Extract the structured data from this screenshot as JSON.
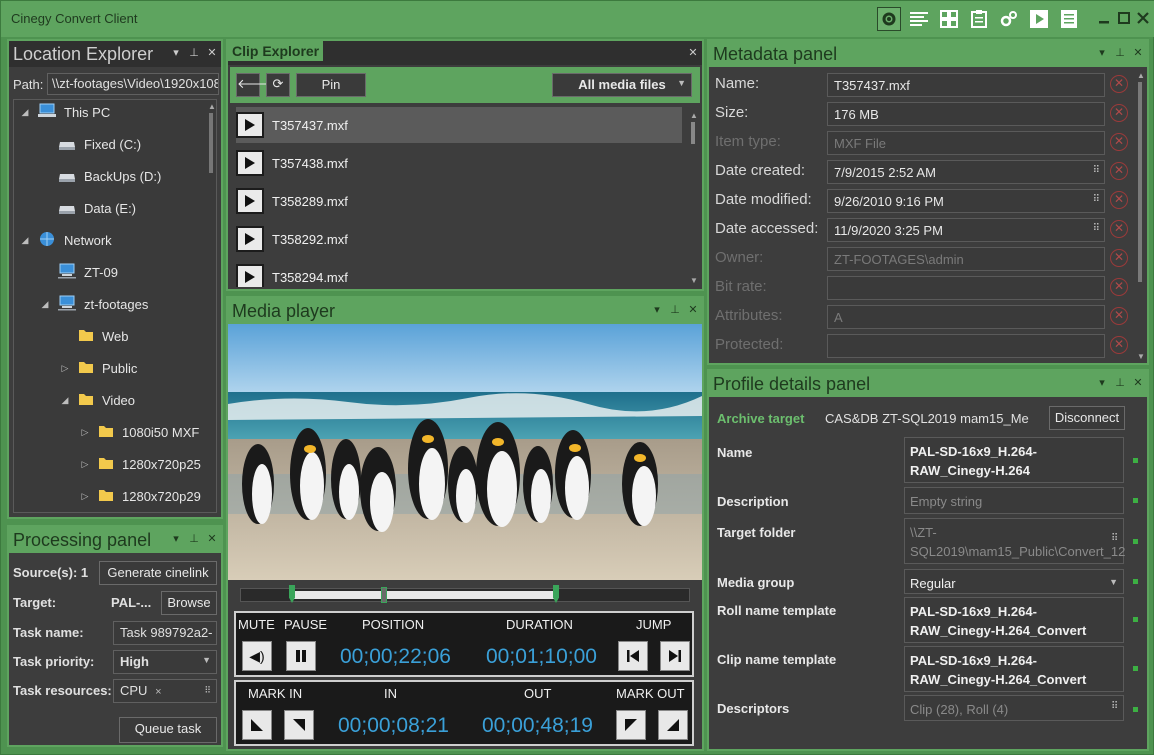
{
  "window": {
    "title": "Cinegy Convert Client"
  },
  "toolbar": {
    "icons": [
      "gear-icon",
      "list-icon",
      "grid-icon",
      "clipboard-icon",
      "settings-cogs-icon",
      "play-icon",
      "document-list-icon"
    ]
  },
  "location": {
    "title": "Location Explorer",
    "path_label": "Path:",
    "path_value": "\\\\zt-footages\\Video\\1920x108",
    "tree": [
      {
        "label": "This PC",
        "indent": 0,
        "arrow": "▲"
      },
      {
        "label": "Fixed (C:)",
        "indent": 1,
        "arrow": ""
      },
      {
        "label": "BackUps (D:)",
        "indent": 1,
        "arrow": ""
      },
      {
        "label": "Data (E:)",
        "indent": 1,
        "arrow": ""
      },
      {
        "label": "Network",
        "indent": 0,
        "arrow": "▲"
      },
      {
        "label": "ZT-09",
        "indent": 1,
        "arrow": ""
      },
      {
        "label": "zt-footages",
        "indent": 1,
        "arrow": "▲"
      },
      {
        "label": "Web",
        "indent": 2,
        "arrow": ""
      },
      {
        "label": "Public",
        "indent": 2,
        "arrow": "▶"
      },
      {
        "label": "Video",
        "indent": 2,
        "arrow": "▲"
      },
      {
        "label": "1080i50 MXF",
        "indent": 3,
        "arrow": "▶"
      },
      {
        "label": "1280x720p25",
        "indent": 3,
        "arrow": "▶"
      },
      {
        "label": "1280x720p29",
        "indent": 3,
        "arrow": "▶"
      }
    ]
  },
  "processing": {
    "title": "Processing panel",
    "sources_label": "Source(s): 1",
    "generate_btn": "Generate cinelink",
    "target_label": "Target:",
    "target_value": "PAL-...",
    "browse_btn": "Browse",
    "taskname_label": "Task name:",
    "taskname_value": "Task 989792a2-",
    "priority_label": "Task priority:",
    "priority_value": "High",
    "resources_label": "Task resources:",
    "resources_tag": "CPU",
    "queue_btn": "Queue task"
  },
  "clips": {
    "title": "Clip Explorer",
    "pin_btn": "Pin",
    "filter_value": "All media files",
    "items": [
      "T357437.mxf",
      "T357438.mxf",
      "T358289.mxf",
      "T358292.mxf",
      "T358294.mxf"
    ]
  },
  "player": {
    "title": "Media player",
    "mute_label": "MUTE",
    "pause_label": "PAUSE",
    "position_label": "POSITION",
    "position_value": "00;00;22;06",
    "duration_label": "DURATION",
    "duration_value": "00;01;10;00",
    "jump_label": "JUMP",
    "markin_label": "MARK IN",
    "in_label": "IN",
    "in_value": "00;00;08;21",
    "out_label": "OUT",
    "out_value": "00;00;48;19",
    "markout_label": "MARK OUT"
  },
  "metadata": {
    "title": "Metadata panel",
    "rows": [
      {
        "label": "Name:",
        "value": "T357437.mxf",
        "dim": false,
        "picker": false
      },
      {
        "label": "Size:",
        "value": "176 MB",
        "dim": false,
        "picker": false
      },
      {
        "label": "Item type:",
        "value": "MXF File",
        "dim": true,
        "picker": false
      },
      {
        "label": "Date created:",
        "value": "7/9/2015 2:52 AM",
        "dim": false,
        "picker": true
      },
      {
        "label": "Date modified:",
        "value": "9/26/2010 9:16 PM",
        "dim": false,
        "picker": true
      },
      {
        "label": "Date accessed:",
        "value": "11/9/2020 3:25 PM",
        "dim": false,
        "picker": true
      },
      {
        "label": "Owner:",
        "value": "ZT-FOOTAGES\\admin",
        "dim": true,
        "picker": false
      },
      {
        "label": "Bit rate:",
        "value": "",
        "dim": true,
        "picker": false
      },
      {
        "label": "Attributes:",
        "value": "A",
        "dim": true,
        "picker": false
      },
      {
        "label": "Protected:",
        "value": "",
        "dim": true,
        "picker": false
      }
    ]
  },
  "profile": {
    "title": "Profile details panel",
    "archive_label": "Archive target",
    "archive_value": "CAS&DB ZT-SQL2019 mam15_Me",
    "disconnect_btn": "Disconnect",
    "name_label": "Name",
    "name_value": "PAL-SD-16x9_H.264-RAW_Cinegy-H.264",
    "desc_label": "Description",
    "desc_value": "Empty string",
    "folder_label": "Target folder",
    "folder_value": "\\\\ZT-SQL2019\\mam15_Public\\Convert_12",
    "mediagroup_label": "Media group",
    "mediagroup_value": "Regular",
    "rollname_label": "Roll name template",
    "rollname_value": "PAL-SD-16x9_H.264-RAW_Cinegy-H.264_Convert",
    "clipname_label": "Clip name template",
    "clipname_value": "PAL-SD-16x9_H.264-RAW_Cinegy-H.264_Convert",
    "descriptors_label": "Descriptors",
    "descriptors_value": "Clip (28), Roll (4)"
  }
}
